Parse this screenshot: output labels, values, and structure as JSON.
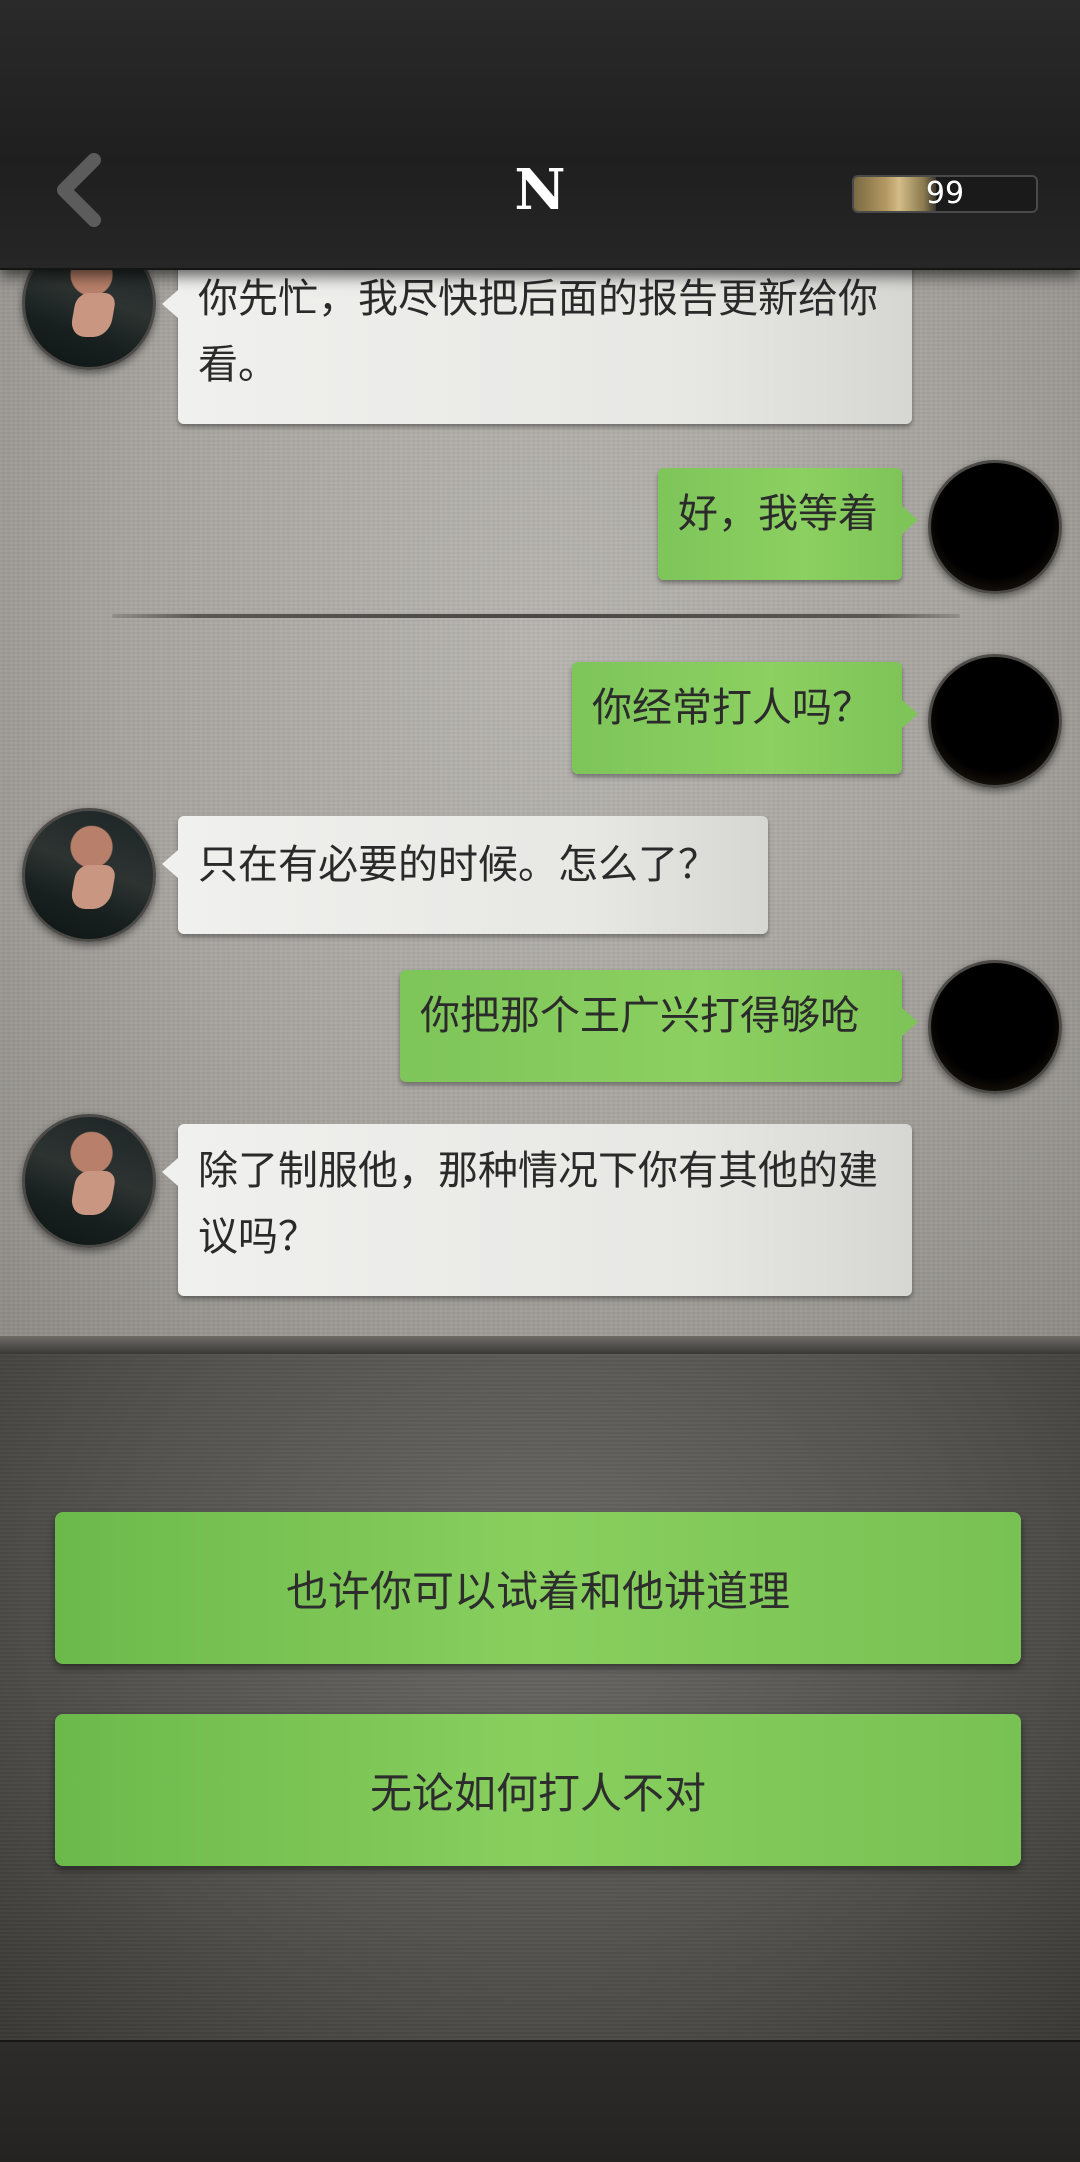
{
  "header": {
    "title": "N",
    "energy_value": "99",
    "energy_fraction": 0.45,
    "back_icon": "chevron-left-icon"
  },
  "messages": [
    {
      "side": "in",
      "text": "你先忙，我尽快把后面的报告更新给你看。"
    },
    {
      "side": "out",
      "text": "好，我等着"
    },
    {
      "side": "out",
      "text": "你经常打人吗？"
    },
    {
      "side": "in",
      "text": "只在有必要的时候。怎么了？"
    },
    {
      "side": "out",
      "text": "你把那个王广兴打得够呛"
    },
    {
      "side": "in",
      "text": "除了制服他，那种情况下你有其他的建议吗？"
    }
  ],
  "choices": [
    {
      "label": "也许你可以试着和他讲道理"
    },
    {
      "label": "无论如何打人不对"
    }
  ],
  "colors": {
    "bubble_out": "#86cd5d",
    "bubble_in": "#ecebe8",
    "choice_button": "#7fc657",
    "header_bg": "#232323"
  }
}
